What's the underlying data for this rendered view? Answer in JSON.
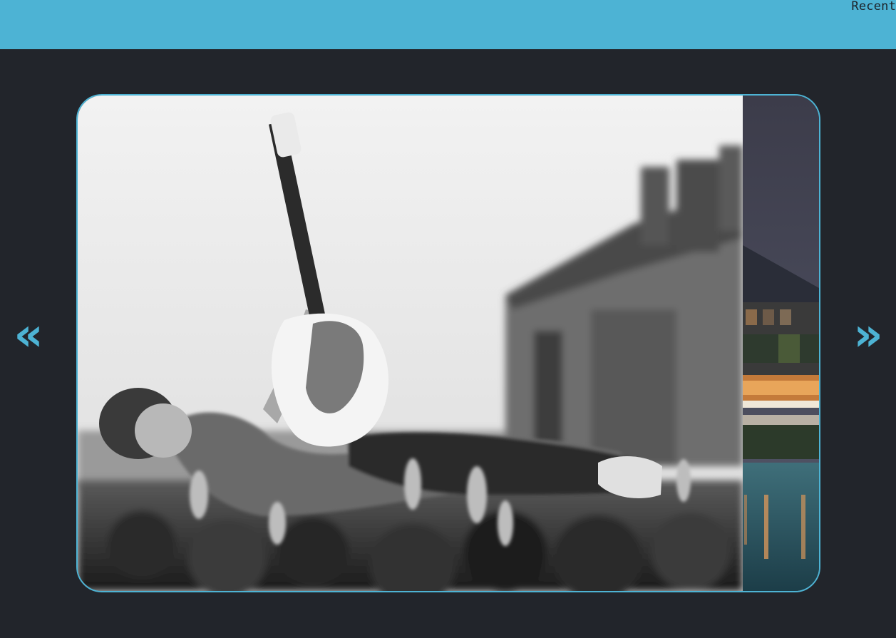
{
  "header": {
    "recent_label": "Recent"
  },
  "carousel": {
    "prev_label": "«",
    "next_label": "»",
    "accent_color": "#4db3d4",
    "slides": [
      {
        "description_icon": "concert-crowd-surfer-photo"
      },
      {
        "description_icon": "night-hotel-pool-photo"
      }
    ]
  }
}
